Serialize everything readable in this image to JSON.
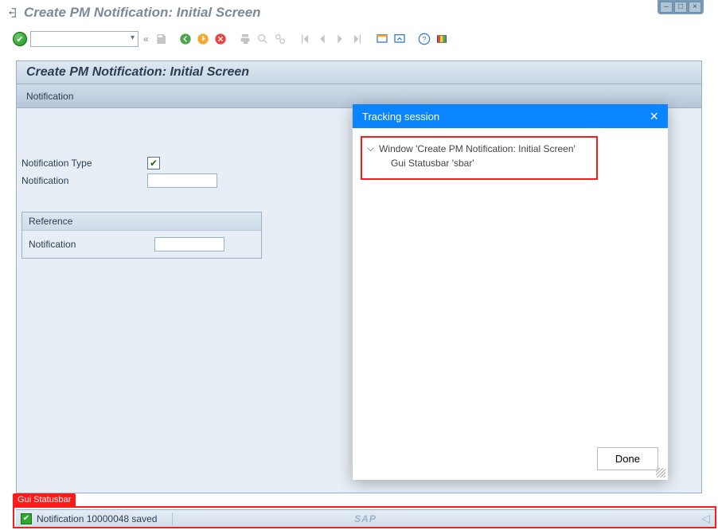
{
  "window": {
    "title": "Create PM Notification: Initial Screen"
  },
  "toolbar": {
    "double_chevron": "«"
  },
  "screen": {
    "title": "Create PM Notification: Initial Screen",
    "appbar_label": "Notification"
  },
  "form": {
    "notif_type_label": "Notification Type",
    "notif_type_checked": "✔",
    "notif_label": "Notification",
    "notif_value": "",
    "ref_header": "Reference",
    "ref_notif_label": "Notification",
    "ref_notif_value": ""
  },
  "callout": {
    "label": "Gui Statusbar"
  },
  "statusbar": {
    "message": "Notification 10000048 saved",
    "logo": "SAP"
  },
  "popup": {
    "title": "Tracking session",
    "close": "×",
    "tree_root_prefix": "⌵",
    "tree_root": "Window 'Create PM Notification: Initial Screen'",
    "tree_child": "Gui Statusbar 'sbar'",
    "done": "Done"
  }
}
